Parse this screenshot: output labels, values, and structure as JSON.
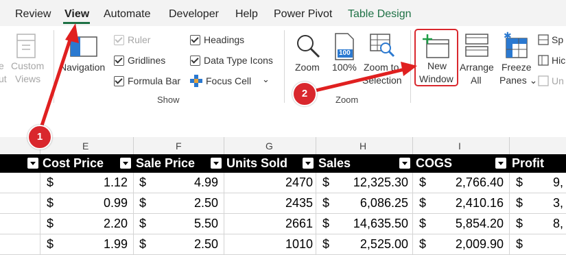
{
  "tabs": [
    {
      "label": "Review"
    },
    {
      "label": "View",
      "active": true
    },
    {
      "label": "Automate"
    },
    {
      "label": "Developer"
    },
    {
      "label": "Help"
    },
    {
      "label": "Power Pivot"
    },
    {
      "label": "Table Design"
    }
  ],
  "ribbon": {
    "left_cut": {
      "line1": "e",
      "line2": "ut"
    },
    "custom_views": {
      "line1": "Custom",
      "line2": "Views"
    },
    "navigation": "Navigation",
    "show": {
      "ruler": "Ruler",
      "gridlines": "Gridlines",
      "formula_bar": "Formula Bar",
      "headings": "Headings",
      "data_type_icons": "Data Type Icons",
      "focus_cell": "Focus Cell",
      "group_label": "Show"
    },
    "zoom": {
      "zoom": "Zoom",
      "hundred": "100%",
      "hundred_icon_text": "100",
      "zoom_to_line1": "Zoom to",
      "zoom_to_line2": "Selection",
      "group_label": "Zoom"
    },
    "window": {
      "new_line1": "New",
      "new_line2": "Window",
      "arrange_line1": "Arrange",
      "arrange_line2": "All",
      "freeze_line1": "Freeze",
      "freeze_line2": "Panes ⌄",
      "split": "Sp",
      "hide": "Hic",
      "unhide": "Un"
    }
  },
  "columns": [
    "E",
    "F",
    "G",
    "H",
    "I"
  ],
  "annotations": {
    "step1": "1",
    "step2": "2"
  },
  "table": {
    "headers": [
      "Cost Price",
      "Sale Price",
      "Units Sold",
      "Sales",
      "COGS",
      "Profit"
    ],
    "rows": [
      {
        "cost": "1.12",
        "sale": "4.99",
        "units": "2470",
        "sales": "12,325.30",
        "cogs": "2,766.40",
        "profit": "9,"
      },
      {
        "cost": "0.99",
        "sale": "2.50",
        "units": "2435",
        "sales": "6,086.25",
        "cogs": "2,410.16",
        "profit": "3,"
      },
      {
        "cost": "2.20",
        "sale": "5.50",
        "units": "2661",
        "sales": "14,635.50",
        "cogs": "5,854.20",
        "profit": "8,"
      },
      {
        "cost": "1.99",
        "sale": "2.50",
        "units": "1010",
        "sales": "2,525.00",
        "cogs": "2,009.90",
        "profit": ""
      }
    ],
    "currency": "$"
  },
  "colors": {
    "accent": "#1e7145",
    "annotation": "#d9272d"
  }
}
